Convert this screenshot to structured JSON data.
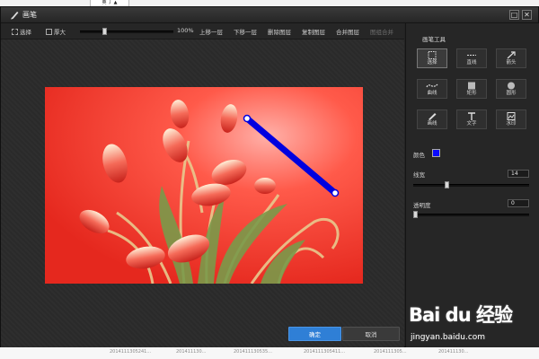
{
  "top": {
    "ime_label": "英 丿 ▲"
  },
  "window": {
    "title": "画笔",
    "minimize": "□",
    "close": "✕"
  },
  "toolbar": {
    "select": "选择",
    "thick": "厚大",
    "zoom_level": "100%",
    "zoom_fraction": 0.25,
    "move_up": "上移一层",
    "move_down": "下移一层",
    "delete_layer": "删除图层",
    "copy_layer": "复制图层",
    "merge_layer": "合并图层",
    "flatten": "图组合并"
  },
  "panel": {
    "title": "画笔工具",
    "tools": [
      {
        "label": "选择",
        "icon": "select-icon"
      },
      {
        "label": "直线",
        "icon": "line-icon"
      },
      {
        "label": "箭头",
        "icon": "arrow-icon"
      },
      {
        "label": "曲线",
        "icon": "curve-icon"
      },
      {
        "label": "矩形",
        "icon": "rectangle-icon"
      },
      {
        "label": "圆形",
        "icon": "circle-icon"
      },
      {
        "label": "画线",
        "icon": "pen-icon"
      },
      {
        "label": "文字",
        "icon": "text-icon"
      },
      {
        "label": "水印",
        "icon": "watermark-icon"
      }
    ],
    "color_label": "颜色",
    "color_value": "#0a0aff",
    "width_label": "线宽",
    "width_value": "14",
    "width_fraction": 0.28,
    "opacity_label": "透明度",
    "opacity_value": "0",
    "opacity_fraction": 0.0
  },
  "actions": {
    "ok": "确定",
    "cancel": "取消"
  },
  "footer": {
    "items": [
      "2014111305241... ",
      "201411130...",
      "201411130535...",
      "2014111305411...",
      "2014111305...",
      "201411130..."
    ]
  },
  "watermark": {
    "brand": "Bai du 经验",
    "site": "jingyan.baidu.com"
  }
}
